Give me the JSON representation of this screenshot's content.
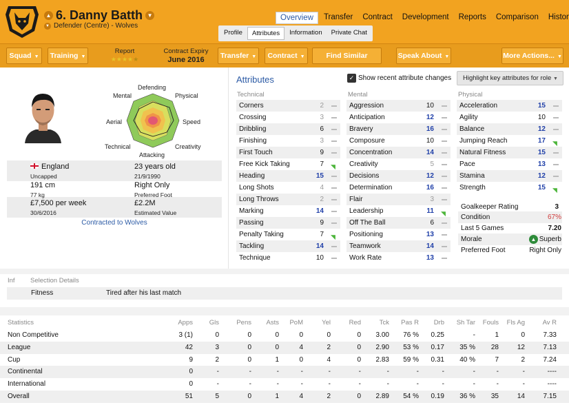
{
  "player": {
    "number_name": "6. Danny Batth",
    "position_club": "Defender (Centre) - Wolves"
  },
  "topnav": [
    "Overview",
    "Transfer",
    "Contract",
    "Development",
    "Reports",
    "Comparison",
    "History"
  ],
  "subnav": [
    "Profile",
    "Attributes",
    "Information",
    "Private Chat"
  ],
  "toolbar": {
    "squad": "Squad",
    "training": "Training",
    "report_label": "Report",
    "report_stars": 4.5,
    "contract_label": "Contract Expiry",
    "contract_value": "June 2016",
    "transfer": "Transfer",
    "contract": "Contract",
    "similar": "Find Similar Players",
    "speak": "Speak About",
    "more": "More Actions..."
  },
  "radar": {
    "mental": "Mental",
    "defending": "Defending",
    "physical": "Physical",
    "aerial": "Aerial",
    "speed": "Speed",
    "technical": "Technical",
    "attacking": "Attacking",
    "creativity": "Creativity"
  },
  "profile": {
    "nation": "England",
    "caps": "Uncapped",
    "age": "23 years old",
    "dob": "21/9/1990",
    "height": "191 cm",
    "weight": "77 kg",
    "foot": "Right Only",
    "foot_label": "Preferred Foot",
    "wage": "£7,500 per week",
    "expires": "30/6/2016",
    "value": "£2.2M",
    "value_label": "Estimated Value",
    "contracted": "Contracted to Wolves"
  },
  "attributes": {
    "title": "Attributes",
    "show_changes": "Show recent attribute changes",
    "highlight": "Highlight key attributes for role",
    "technical_head": "Technical",
    "mental_head": "Mental",
    "physical_head": "Physical",
    "technical": [
      {
        "n": "Corners",
        "v": "2",
        "s": "gr"
      },
      {
        "n": "Crossing",
        "v": "3",
        "s": "gr"
      },
      {
        "n": "Dribbling",
        "v": "6",
        "s": ""
      },
      {
        "n": "Finishing",
        "v": "3",
        "s": "gr"
      },
      {
        "n": "First Touch",
        "v": "9",
        "s": ""
      },
      {
        "n": "Free Kick Taking",
        "v": "7",
        "s": "",
        "up": true
      },
      {
        "n": "Heading",
        "v": "15",
        "s": "bl"
      },
      {
        "n": "Long Shots",
        "v": "4",
        "s": "gr"
      },
      {
        "n": "Long Throws",
        "v": "2",
        "s": "gr"
      },
      {
        "n": "Marking",
        "v": "14",
        "s": "bl"
      },
      {
        "n": "Passing",
        "v": "9",
        "s": ""
      },
      {
        "n": "Penalty Taking",
        "v": "7",
        "s": "",
        "up": true
      },
      {
        "n": "Tackling",
        "v": "14",
        "s": "bl"
      },
      {
        "n": "Technique",
        "v": "10",
        "s": ""
      }
    ],
    "mental": [
      {
        "n": "Aggression",
        "v": "10",
        "s": ""
      },
      {
        "n": "Anticipation",
        "v": "12",
        "s": "bl"
      },
      {
        "n": "Bravery",
        "v": "16",
        "s": "bl"
      },
      {
        "n": "Composure",
        "v": "10",
        "s": ""
      },
      {
        "n": "Concentration",
        "v": "14",
        "s": "bl"
      },
      {
        "n": "Creativity",
        "v": "5",
        "s": "gr"
      },
      {
        "n": "Decisions",
        "v": "12",
        "s": "bl"
      },
      {
        "n": "Determination",
        "v": "16",
        "s": "bl"
      },
      {
        "n": "Flair",
        "v": "3",
        "s": "gr"
      },
      {
        "n": "Leadership",
        "v": "11",
        "s": "bl",
        "up": true
      },
      {
        "n": "Off The Ball",
        "v": "6",
        "s": ""
      },
      {
        "n": "Positioning",
        "v": "13",
        "s": "bl"
      },
      {
        "n": "Teamwork",
        "v": "14",
        "s": "bl"
      },
      {
        "n": "Work Rate",
        "v": "13",
        "s": "bl"
      }
    ],
    "physical": [
      {
        "n": "Acceleration",
        "v": "15",
        "s": "bl"
      },
      {
        "n": "Agility",
        "v": "10",
        "s": ""
      },
      {
        "n": "Balance",
        "v": "12",
        "s": "bl"
      },
      {
        "n": "Jumping Reach",
        "v": "17",
        "s": "bl",
        "up": true
      },
      {
        "n": "Natural Fitness",
        "v": "15",
        "s": "bl"
      },
      {
        "n": "Pace",
        "v": "13",
        "s": "bl"
      },
      {
        "n": "Stamina",
        "v": "12",
        "s": "bl"
      },
      {
        "n": "Strength",
        "v": "15",
        "s": "bl",
        "up": true
      }
    ],
    "extra": [
      {
        "n": "Goalkeeper Rating",
        "v": "3"
      },
      {
        "n": "Condition",
        "v": "67%"
      },
      {
        "n": "Last 5 Games",
        "v": "7.20"
      },
      {
        "n": "Morale",
        "v": "Superb"
      },
      {
        "n": "Preferred Foot",
        "v": "Right Only"
      }
    ]
  },
  "selection": {
    "inf": "Inf",
    "title": "Selection Details",
    "fitness": "Fitness",
    "fitness_value": "Tired after his last match"
  },
  "stats": {
    "title": "Statistics",
    "headers": [
      "Apps",
      "Gls",
      "Pens",
      "Asts",
      "PoM",
      "Yel",
      "Red",
      "Tck",
      "Pas R",
      "Drb",
      "Sh Tar",
      "Fouls",
      "Fls Ag",
      "Av R"
    ],
    "rows": [
      {
        "label": "Non Competitive",
        "vals": [
          "3 (1)",
          "0",
          "0",
          "0",
          "0",
          "0",
          "0",
          "3.00",
          "76 %",
          "0.25",
          "-",
          "1",
          "0",
          "7.33"
        ]
      },
      {
        "label": "League",
        "vals": [
          "42",
          "3",
          "0",
          "0",
          "4",
          "2",
          "0",
          "2.90",
          "53 %",
          "0.17",
          "35 %",
          "28",
          "12",
          "7.13"
        ]
      },
      {
        "label": "Cup",
        "vals": [
          "9",
          "2",
          "0",
          "1",
          "0",
          "4",
          "0",
          "2.83",
          "59 %",
          "0.31",
          "40 %",
          "7",
          "2",
          "7.24"
        ]
      },
      {
        "label": "Continental",
        "vals": [
          "0",
          "-",
          "-",
          "-",
          "-",
          "-",
          "-",
          "-",
          "-",
          "-",
          "-",
          "-",
          "-",
          "----"
        ]
      },
      {
        "label": "International",
        "vals": [
          "0",
          "-",
          "-",
          "-",
          "-",
          "-",
          "-",
          "-",
          "-",
          "-",
          "-",
          "-",
          "-",
          "----"
        ]
      },
      {
        "label": "Overall",
        "vals": [
          "51",
          "5",
          "0",
          "1",
          "4",
          "2",
          "0",
          "2.89",
          "54 %",
          "0.19",
          "36 %",
          "35",
          "14",
          "7.15"
        ]
      }
    ]
  },
  "colors": {
    "orange": "#f2a320",
    "blue": "#1f3fa8",
    "link": "#2b5aa5"
  }
}
